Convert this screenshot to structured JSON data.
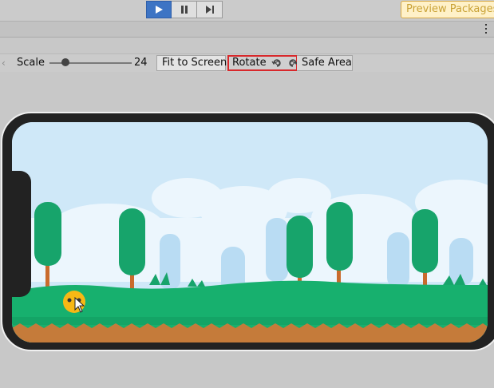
{
  "toolbar": {
    "play_icon": "play-icon",
    "pause_icon": "pause-icon",
    "step_icon": "step-icon",
    "preview_label": "Preview Packages",
    "accent": "#3d74c4",
    "preview_color": "#c9a236"
  },
  "game_view": {
    "more_icon": "kebab-menu-icon",
    "scale_label": "Scale",
    "scale_value": "24",
    "fit_label": "Fit to Screen",
    "rotate_label": "Rotate",
    "rotate_left_icon": "rotate-left-icon",
    "rotate_right_icon": "rotate-right-icon",
    "safe_area_label": "Safe Area",
    "highlight_color": "#d8282b"
  },
  "scene": {
    "sky_color": "#cfe8f8",
    "grass_color": "#17b06e",
    "soil_color": "#c57b3a",
    "player_icon": "player-ball-icon",
    "cursor_icon": "mouse-cursor-icon"
  }
}
